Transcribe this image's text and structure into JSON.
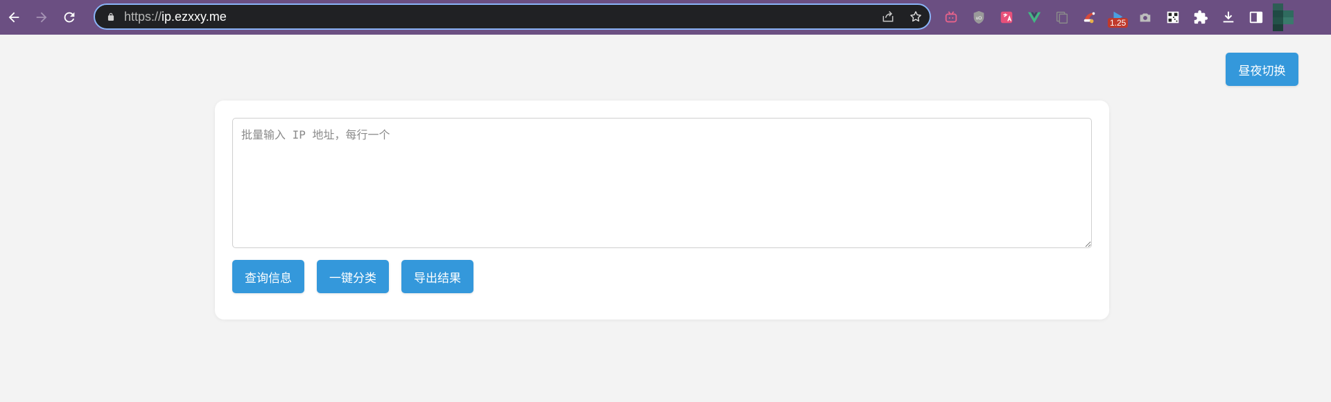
{
  "browser": {
    "toolbar_color": "#6b4f82",
    "nav_icons": [
      "back-arrow-icon",
      "forward-arrow-icon",
      "reload-icon"
    ],
    "url_scheme": "https://",
    "url_host": "ip.ezxxy.me",
    "omnibox_icons": [
      "share-icon",
      "bookmark-star-icon"
    ],
    "extensions": [
      {
        "name": "bilibili-tv-icon",
        "color": "#e8638b"
      },
      {
        "name": "ublock-shield-icon",
        "color": "#a8a8a8"
      },
      {
        "name": "translate-icon",
        "color": "#e8507a"
      },
      {
        "name": "vue-devtools-icon",
        "color": "#42b883"
      },
      {
        "name": "copy-pages-icon",
        "color": "#8a8a8a"
      },
      {
        "name": "christmas-hat-icon",
        "color": "#d64a3a"
      },
      {
        "name": "video-speed-icon",
        "color": "#4a9fe0",
        "badge": "1.25"
      },
      {
        "name": "camera-icon",
        "color": "#bdbdbd"
      },
      {
        "name": "qr-code-icon",
        "color": "#ffffff"
      },
      {
        "name": "puzzle-extensions-icon",
        "color": "#ffffff"
      },
      {
        "name": "download-icon",
        "color": "#ffffff"
      },
      {
        "name": "side-panel-icon",
        "color": "#ffffff"
      }
    ]
  },
  "page": {
    "theme_toggle_label": "昼夜切换",
    "input_placeholder": "批量输入 IP 地址，每行一个",
    "input_value": "",
    "buttons": {
      "query": "查询信息",
      "classify": "一键分类",
      "export": "导出结果"
    },
    "accent_color": "#3498db",
    "background_color": "#f3f3f3"
  }
}
